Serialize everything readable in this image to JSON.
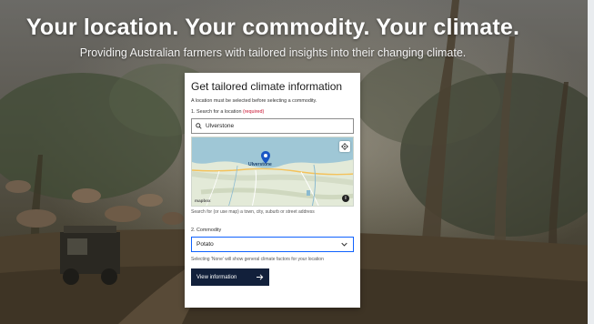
{
  "hero": {
    "headline": "Your location. Your commodity. Your climate.",
    "subhead": "Providing Australian farmers with tailored insights into their changing climate."
  },
  "card": {
    "title": "Get tailored climate information",
    "note": "A location must be selected before selecting a commodity.",
    "location_label": "1. Search for a location",
    "location_required": "(required)",
    "search_value": "Ulverstone",
    "map_place_label": "Ulverstone",
    "map_logo": "mapbox",
    "search_hint": "Search for (or use map) a town, city, suburb or street address",
    "commodity_label": "2. Commodity",
    "commodity_value": "Potato",
    "commodity_hint": "Selecting 'None' will show general climate factors for your location",
    "view_button_label": "View information",
    "view_button_icon": "arrow-right-icon"
  },
  "colors": {
    "button_bg": "#12203b",
    "select_border": "#0f62fe",
    "required": "#c8102e",
    "pin": "#1a56c4"
  }
}
